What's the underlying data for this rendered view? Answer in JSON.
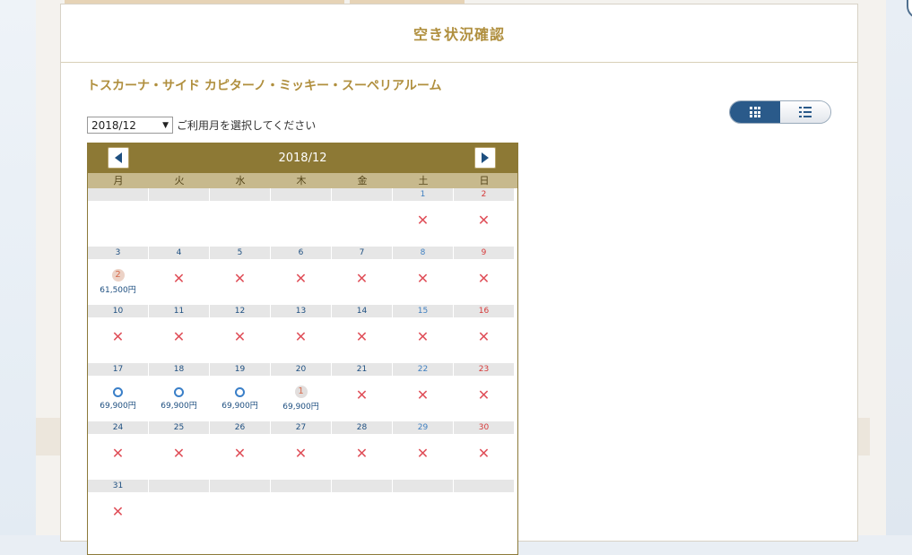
{
  "modal": {
    "title": "空き状況確認",
    "close_label": "×"
  },
  "room_name": "トスカーナ・サイド カピターノ・ミッキー・スーペリアルーム",
  "month_select": {
    "value": "2018/12",
    "hint": "ご利用月を選択してください"
  },
  "calendar": {
    "title": "2018/12",
    "weekdays": [
      "月",
      "火",
      "水",
      "木",
      "金",
      "土",
      "日"
    ],
    "weeks": [
      [
        {
          "day": "",
          "status": "none"
        },
        {
          "day": "",
          "status": "none"
        },
        {
          "day": "",
          "status": "none"
        },
        {
          "day": "",
          "status": "none"
        },
        {
          "day": "",
          "status": "none"
        },
        {
          "day": "1",
          "status": "full"
        },
        {
          "day": "2",
          "status": "full"
        }
      ],
      [
        {
          "day": "3",
          "status": "few",
          "count": "2",
          "price": "61,500円"
        },
        {
          "day": "4",
          "status": "full"
        },
        {
          "day": "5",
          "status": "full"
        },
        {
          "day": "6",
          "status": "full"
        },
        {
          "day": "7",
          "status": "full"
        },
        {
          "day": "8",
          "status": "full"
        },
        {
          "day": "9",
          "status": "full"
        }
      ],
      [
        {
          "day": "10",
          "status": "full"
        },
        {
          "day": "11",
          "status": "full"
        },
        {
          "day": "12",
          "status": "full"
        },
        {
          "day": "13",
          "status": "full"
        },
        {
          "day": "14",
          "status": "full"
        },
        {
          "day": "15",
          "status": "full"
        },
        {
          "day": "16",
          "status": "full"
        }
      ],
      [
        {
          "day": "17",
          "status": "available",
          "price": "69,900円"
        },
        {
          "day": "18",
          "status": "available",
          "price": "69,900円"
        },
        {
          "day": "19",
          "status": "available",
          "price": "69,900円"
        },
        {
          "day": "20",
          "status": "few",
          "count": "1",
          "price": "69,900円"
        },
        {
          "day": "21",
          "status": "full"
        },
        {
          "day": "22",
          "status": "full"
        },
        {
          "day": "23",
          "status": "full"
        }
      ],
      [
        {
          "day": "24",
          "status": "full"
        },
        {
          "day": "25",
          "status": "full"
        },
        {
          "day": "26",
          "status": "full"
        },
        {
          "day": "27",
          "status": "full"
        },
        {
          "day": "28",
          "status": "full"
        },
        {
          "day": "29",
          "status": "full"
        },
        {
          "day": "30",
          "status": "full"
        }
      ],
      [
        {
          "day": "31",
          "status": "full"
        },
        {
          "day": "",
          "status": "none"
        },
        {
          "day": "",
          "status": "none"
        },
        {
          "day": "",
          "status": "none"
        },
        {
          "day": "",
          "status": "none"
        },
        {
          "day": "",
          "status": "none"
        },
        {
          "day": "",
          "status": "none"
        }
      ]
    ]
  },
  "view_toggle": {
    "active": "grid",
    "icons": [
      "grid-icon",
      "list-icon"
    ]
  },
  "colors": {
    "accent_gold": "#b08f3e",
    "header_bar": "#8d7935",
    "full_mark": "#e0505a",
    "available_mark": "#3a7fc8",
    "toggle_active": "#2a5a8a"
  }
}
